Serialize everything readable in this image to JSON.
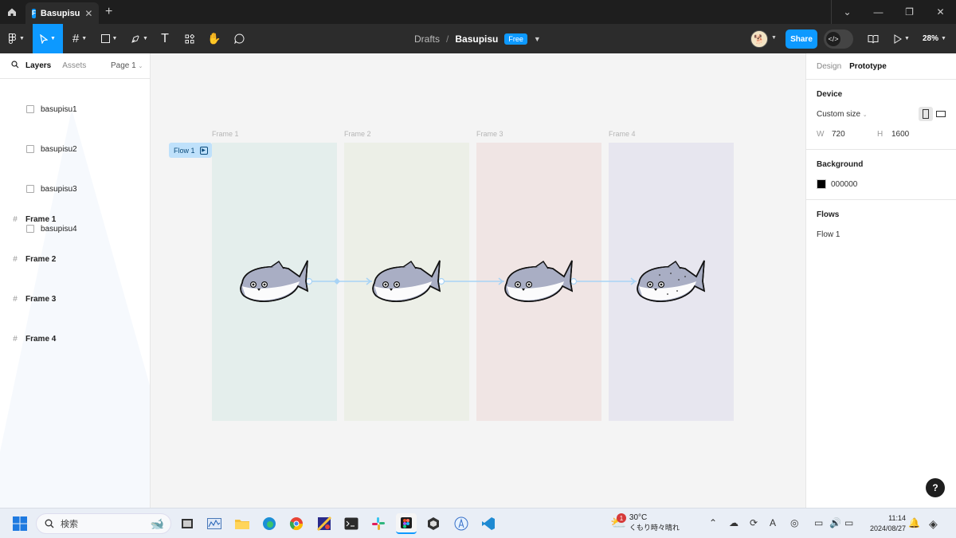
{
  "window": {
    "tab_title": "Basupisu",
    "favicon_glyph": "F"
  },
  "toolbar": {
    "breadcrumb_drafts": "Drafts",
    "breadcrumb_sep": "/",
    "file_name": "Basupisu",
    "plan_badge": "Free",
    "share_label": "Share",
    "zoom_label": "28%"
  },
  "left_panel": {
    "tab_layers": "Layers",
    "tab_assets": "Assets",
    "page_selector": "Page 1",
    "layers": [
      {
        "label": "Frame 1",
        "kind": "frame"
      },
      {
        "label": "basupisu1",
        "kind": "image"
      },
      {
        "label": "Frame 2",
        "kind": "frame"
      },
      {
        "label": "basupisu2",
        "kind": "image"
      },
      {
        "label": "Frame 3",
        "kind": "frame"
      },
      {
        "label": "basupisu3",
        "kind": "image"
      },
      {
        "label": "Frame 4",
        "kind": "frame"
      },
      {
        "label": "basupisu4",
        "kind": "image"
      }
    ]
  },
  "canvas": {
    "flow_badge": "Flow 1",
    "frames": [
      {
        "label": "Frame 1",
        "color": "#e4eeec"
      },
      {
        "label": "Frame 2",
        "color": "#ecefe7"
      },
      {
        "label": "Frame 3",
        "color": "#f0e5e4"
      },
      {
        "label": "Frame 4",
        "color": "#e7e6ef"
      }
    ],
    "connector_color": "#a8d3f5",
    "fish_body_color": "#a9aec4"
  },
  "right_panel": {
    "tab_design": "Design",
    "tab_prototype": "Prototype",
    "device_title": "Device",
    "device_value": "Custom size",
    "w_label": "W",
    "w_value": "720",
    "h_label": "H",
    "h_value": "1600",
    "background_title": "Background",
    "background_hex": "000000",
    "flows_title": "Flows",
    "flow_item": "Flow 1",
    "help_label": "?"
  },
  "taskbar": {
    "search_placeholder": "検索",
    "weather_temp": "30°C",
    "weather_desc": "くもり時々晴れ",
    "weather_badge": "1",
    "time": "11:14",
    "date": "2024/08/27",
    "ime_label": "A"
  }
}
